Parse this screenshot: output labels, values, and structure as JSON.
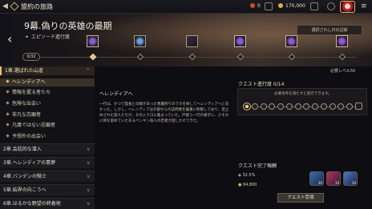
{
  "topbar": {
    "back": "◀",
    "title": "盟約の旅路",
    "stamina": "0",
    "gold": "170,000"
  },
  "hero": {
    "chapter_title": "9幕.偽りの英雄の最期",
    "episode_label": "エピソード進行度",
    "unlock_button": "選択されし日の記録",
    "progress": "0/32",
    "progress_fraction": 0.0,
    "required_level": "必要レベル50"
  },
  "sidebar": {
    "chapters": [
      {
        "label": "1章.選ばれた山道",
        "expanded": true
      },
      {
        "label": "2章.会話的な潜入"
      },
      {
        "label": "3章.ヘレンディアの悪夢"
      },
      {
        "label": "4章.バンデンの騎士"
      },
      {
        "label": "5章.結界の向こうへ"
      },
      {
        "label": "6章.はるかな野望の終着地"
      }
    ],
    "quests": [
      {
        "label": "ヘレンディアへ",
        "active": true
      },
      {
        "label": "情報を握る者たち"
      },
      {
        "label": "危険な出会い"
      },
      {
        "label": "非凡な志願者"
      },
      {
        "label": "凡庸ではない志願者"
      },
      {
        "label": "予想外の出会い"
      }
    ]
  },
  "description": {
    "title": "ヘレンディアへ",
    "text": "一行は、かつて陛長との縁があった悪魔狩りのラタを探してヘレンディアへと向かった。しかし、ヘレンディアは外部からの訪問者を厳重に制限しており、足止めされた旅人たちが、その入り口に集まっていた。戸惑う一行の様子に、ひそかに目を留めていたあるペンギン族人の若者が話しかけてきた。"
  },
  "quest_progress": {
    "title": "クエスト進行度 0/14",
    "note": "必要条件を満たすと進行できます。",
    "steps": 14,
    "current": 0
  },
  "reward": {
    "label": "クエスト完了報酬",
    "exp": "32.5%",
    "gold": "64,800",
    "items": [
      {
        "count": "20"
      },
      {
        "count": "10"
      },
      {
        "count": "10"
      }
    ]
  },
  "accept_button": "クエスト受領"
}
